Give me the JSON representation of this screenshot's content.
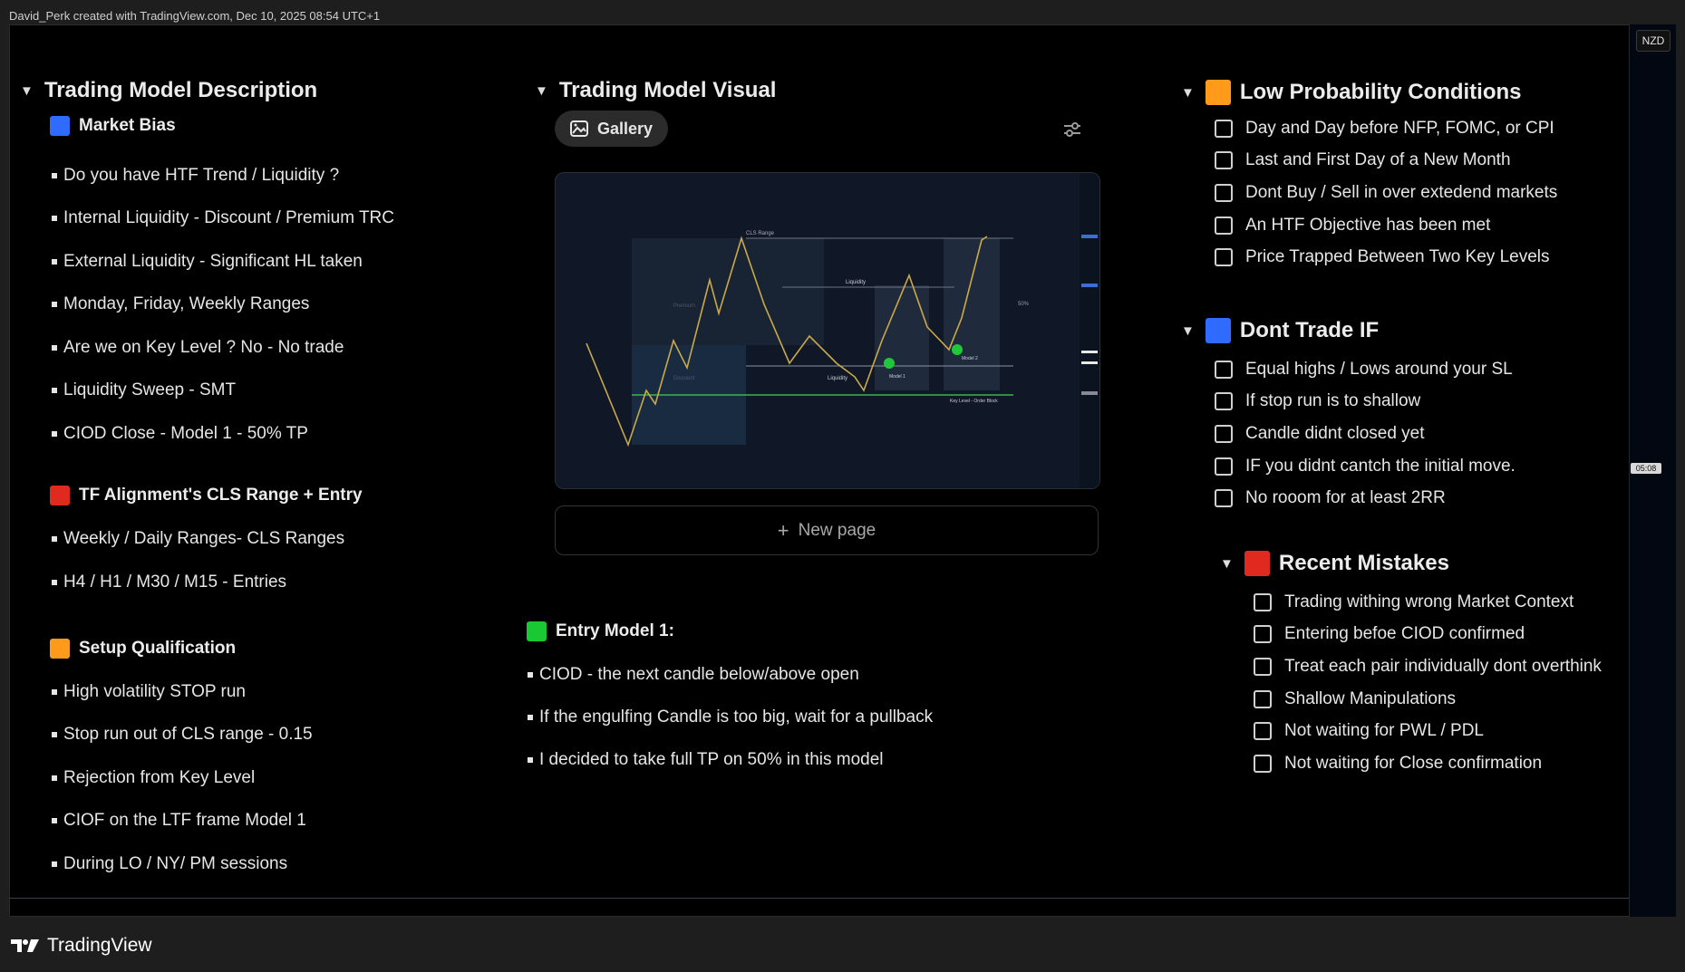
{
  "credit": "David_Perk created with TradingView.com, Dec 10, 2025 08:54 UTC+1",
  "brand": "TradingView",
  "price_axis": {
    "currency": "NZD",
    "time_tag": "05:08"
  },
  "colors": {
    "blue": "#2f6bff",
    "red": "#e02a1f",
    "orange": "#ff9a1a",
    "green": "#19c832",
    "background": "#000000"
  },
  "description": {
    "title": "Trading Model Description",
    "market_bias": {
      "label": "Market Bias",
      "items": [
        "Do you have HTF Trend /  Liquidity ?",
        "Internal Liquidity - Discount / Premium TRC",
        "External Liquidity - Significant HL taken",
        "Monday, Friday, Weekly Ranges",
        "Are we on Key Level ? No - No trade",
        "Liquidity Sweep - SMT",
        "CIOD Close - Model 1 - 50% TP"
      ]
    },
    "tf_alignment": {
      "label": "TF Alignment's CLS Range + Entry",
      "items": [
        "Weekly / Daily Ranges- CLS Ranges",
        "H4 / H1 / M30 / M15  - Entries"
      ]
    },
    "setup": {
      "label": "Setup Qualification",
      "items": [
        "High volatility STOP run",
        "Stop run out of CLS range - 0.15",
        "Rejection from Key Level",
        "CIOF on the LTF frame Model 1",
        "During LO / NY/ PM sessions"
      ]
    }
  },
  "visual": {
    "title": "Trading Model Visual",
    "gallery_label": "Gallery",
    "new_page_label": "New page",
    "chart_labels": {
      "range": "CLS Range",
      "liq_top": "Liquidity",
      "liq_bottom": "Liquidity",
      "premium": "Premium",
      "discount": "Discount",
      "model1": "Model 1",
      "model2": "Model 2",
      "key_level": "Key Level - Order Block",
      "fifty": "50%"
    },
    "entry_model": {
      "label": "Entry Model 1:",
      "items": [
        "CIOD - the next candle below/above open",
        "If the engulfing Candle is too big, wait for a pullback",
        "I decided to take full TP on 50% in this model"
      ]
    }
  },
  "low_prob": {
    "title": "Low Probability Conditions",
    "items": [
      "Day and Day before NFP, FOMC, or CPI",
      "Last and  First Day of a New Month",
      "Dont Buy / Sell in over extedend markets",
      "An HTF Objective has been met",
      "Price Trapped Between Two Key Levels"
    ]
  },
  "dont_trade": {
    "title": "Dont Trade IF",
    "items": [
      "Equal highs / Lows around your SL",
      "If stop run is to shallow",
      "Candle didnt closed yet",
      "IF you didnt cantch the initial move.",
      "No rooom for at least 2RR"
    ]
  },
  "mistakes": {
    "title": "Recent Mistakes",
    "items": [
      "Trading withing wrong Market Context",
      "Entering befoe CIOD confirmed",
      "Treat each pair individually dont overthink",
      "Shallow Manipulations",
      "Not waiting for PWL / PDL",
      "Not waiting for Close confirmation"
    ]
  }
}
